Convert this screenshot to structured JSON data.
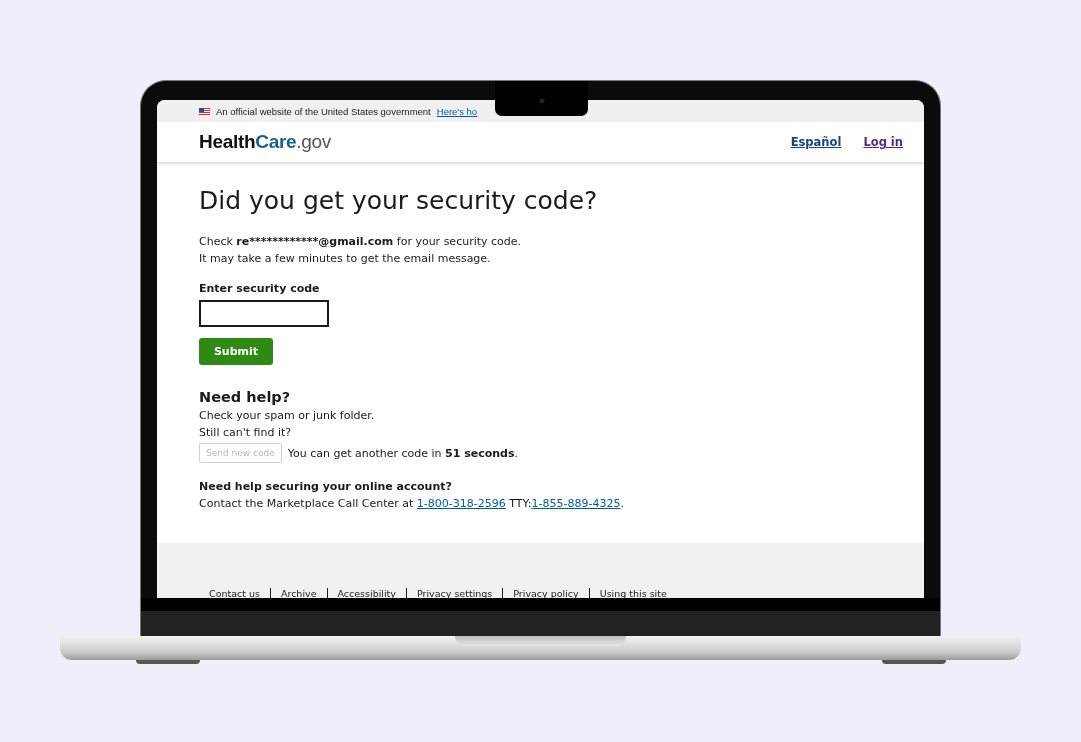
{
  "banner": {
    "text": "An official website of the United States government",
    "link": "Here's ho"
  },
  "header": {
    "logo": [
      {
        "text": "Health",
        "kind": "dark"
      },
      {
        "text": "Care",
        "kind": "blue"
      },
      {
        "text": ".gov",
        "kind": "light"
      }
    ],
    "links": [
      {
        "label": "Español",
        "visited": false
      },
      {
        "label": "Log in",
        "visited": true
      }
    ]
  },
  "main": {
    "title": "Did you get your security code?",
    "email_line": {
      "before": "Check",
      "email": "re************@gmail.com",
      "after": "for your security code."
    },
    "wait_line": "It may take a few minutes to get the email message.",
    "code_field": {
      "label": "Enter security code"
    },
    "submit": "Submit",
    "help": {
      "title": "Need help?",
      "lines": [
        "Check your spam or junk folder.",
        "Still can't find it?"
      ],
      "resend": {
        "label": "Send new code",
        "disabled": true
      },
      "countdown": "You can get another code in **51 seconds**."
    },
    "account": {
      "title": "Need help securing your online account?",
      "text": "Contact the Marketplace Call Center at",
      "phone": "1-800-318-2596",
      "tty_label": "TTY:",
      "tty": "1-855-889-4325",
      "end": "."
    }
  },
  "footer": {
    "links": [
      "Contact us",
      "Archive",
      "Accessibility",
      "Privacy settings",
      "Privacy policy",
      "Using this site"
    ]
  }
}
